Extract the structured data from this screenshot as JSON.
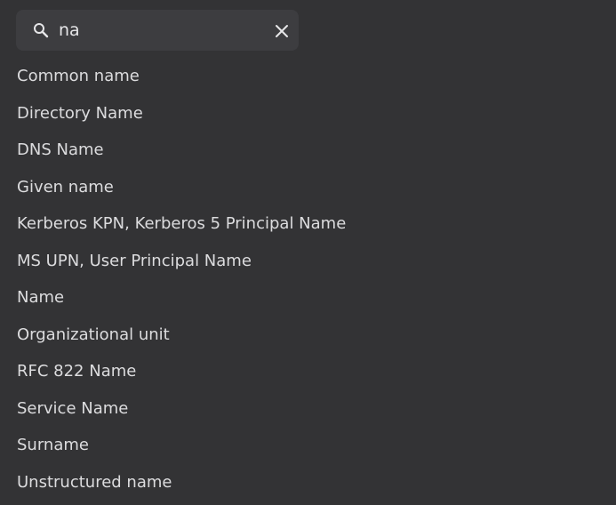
{
  "search": {
    "value": "na",
    "icon": "search-icon",
    "clear_icon": "close-icon"
  },
  "results": [
    "Common name",
    "Directory Name",
    "DNS Name",
    "Given name",
    "Kerberos KPN, Kerberos 5 Principal Name",
    "MS UPN, User Principal Name",
    "Name",
    "Organizational unit",
    "RFC 822 Name",
    "Service Name",
    "Surname",
    "Unstructured name"
  ],
  "colors": {
    "background": "#333335",
    "search_background": "#3d3d40",
    "text": "#dcdcde"
  }
}
